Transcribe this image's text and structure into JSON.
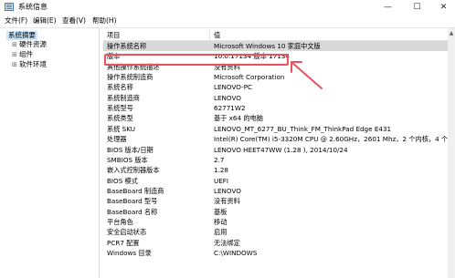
{
  "window": {
    "title": "系统信息",
    "minimize_glyph": "—",
    "maximize_glyph": "☐",
    "close_glyph": "✕",
    "accent": "#e8535e"
  },
  "menu": {
    "items": [
      "文件(F)",
      "编辑(E)",
      "查看(V)",
      "帮助(H)"
    ]
  },
  "sidebar": {
    "root": "系统摘要",
    "children": [
      {
        "label": "硬件资源",
        "expander": "⊞"
      },
      {
        "label": "组件",
        "expander": "⊞"
      },
      {
        "label": "软件环境",
        "expander": "⊞"
      }
    ]
  },
  "table": {
    "headers": {
      "key": "项目",
      "value": "值"
    },
    "selected_index": 0,
    "rows": [
      {
        "key": "操作系统名称",
        "value": "Microsoft Windows 10 家庭中文版"
      },
      {
        "key": "版本",
        "value": "10.0.17134 版本 17134"
      },
      {
        "key": "其他操作系统描述",
        "value": "没有资料"
      },
      {
        "key": "操作系统制造商",
        "value": "Microsoft Corporation"
      },
      {
        "key": "系统名称",
        "value": "LENOVO-PC"
      },
      {
        "key": "系统制造商",
        "value": "LENOVO"
      },
      {
        "key": "系统型号",
        "value": "62771W2"
      },
      {
        "key": "系统类型",
        "value": "基于 x64 的电脑"
      },
      {
        "key": "系统 SKU",
        "value": "LENOVO_MT_6277_BU_Think_FM_ThinkPad Edge E431"
      },
      {
        "key": "处理器",
        "value": "Intel(R) Core(TM) i5-3320M CPU @ 2.60GHz，2601 Mhz，2 个内核，4 个逻辑"
      },
      {
        "key": "BIOS 版本/日期",
        "value": "LENOVO HEET47WW (1.28 ), 2014/10/24"
      },
      {
        "key": "SMBIOS 版本",
        "value": "2.7"
      },
      {
        "key": "嵌入式控制器版本",
        "value": "1.28"
      },
      {
        "key": "BIOS 模式",
        "value": "UEFI"
      },
      {
        "key": "BaseBoard 制造商",
        "value": "LENOVO"
      },
      {
        "key": "BaseBoard 型号",
        "value": "没有资料"
      },
      {
        "key": "BaseBoard 名称",
        "value": "基板"
      },
      {
        "key": "平台角色",
        "value": "移动"
      },
      {
        "key": "安全启动状态",
        "value": "启用"
      },
      {
        "key": "PCR7 配置",
        "value": "无法绑定"
      },
      {
        "key": "Windows 目录",
        "value": "C:\\WINDOWS"
      }
    ]
  },
  "annotation": {
    "highlighted_row": "版本",
    "color": "#e8535e"
  }
}
